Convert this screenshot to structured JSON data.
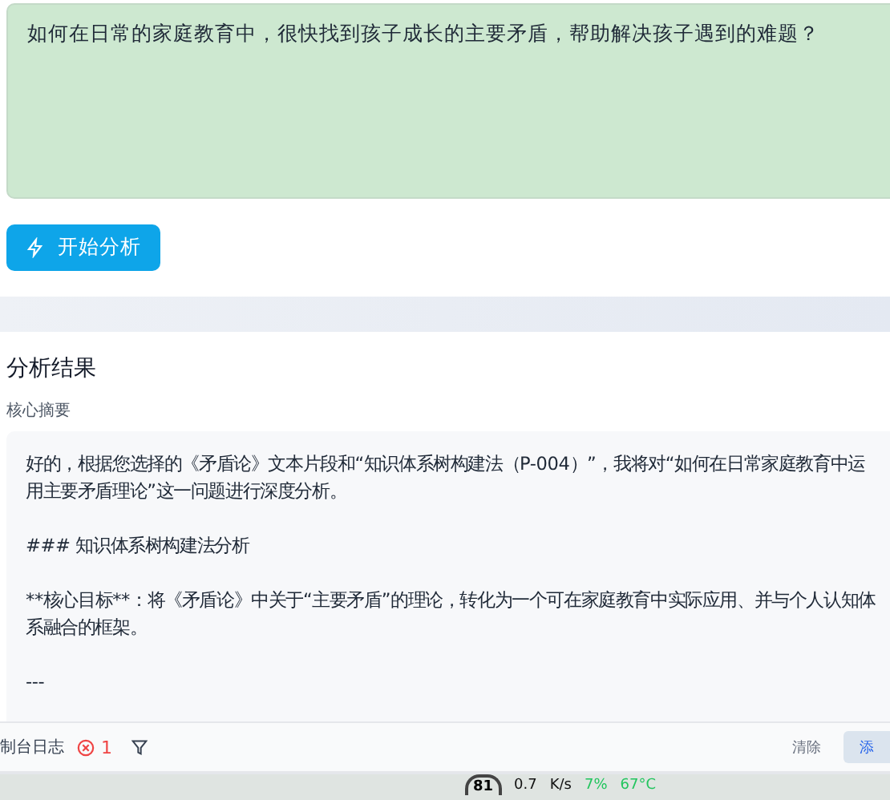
{
  "question": {
    "value": "如何在日常的家庭教育中，很快找到孩子成长的主要矛盾，帮助解决孩子遇到的难题？"
  },
  "analyze_button": {
    "label": "开始分析"
  },
  "result": {
    "title": "分析结果",
    "summary_label": "核心摘要",
    "paragraphs": [
      "好的，根据您选择的《矛盾论》文本片段和“知识体系树构建法（P-004）”，我将对“如何在日常家庭教育中运用主要矛盾理论”这一问题进行深度分析。",
      "### 知识体系树构建法分析",
      "**核心目标**：将《矛盾论》中关于“主要矛盾”的理论，转化为一个可在家庭教育中实际应用、并与个人认知体系融合的框架。",
      "---"
    ]
  },
  "console_bar": {
    "title": "制台日志",
    "error_count": "1",
    "clear": "清除",
    "add": "添"
  },
  "taskbar": {
    "badge": "81",
    "speed": "0.7",
    "speed_unit": "K/s",
    "cpu": "7%",
    "temperature": "67°C"
  }
}
